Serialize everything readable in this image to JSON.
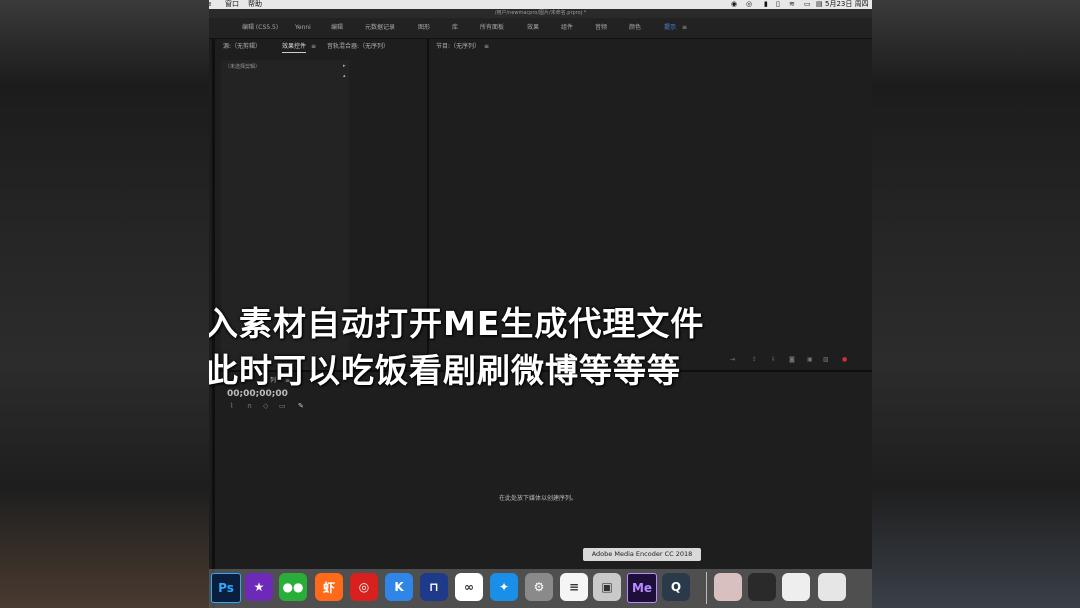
{
  "menubar": {
    "left_items": [
      "窗口",
      "帮助"
    ],
    "date": "5月23日 周四"
  },
  "window": {
    "title": "/用户/newmacpro/图片/未命名.prproj *"
  },
  "workspaces": [
    {
      "label": "编辑 (CS5.5)",
      "active": false
    },
    {
      "label": "Yenni",
      "active": false
    },
    {
      "label": "编辑",
      "active": false
    },
    {
      "label": "元数据记录",
      "active": false
    },
    {
      "label": "图形",
      "active": false
    },
    {
      "label": "库",
      "active": false
    },
    {
      "label": "所有面板",
      "active": false
    },
    {
      "label": "效果",
      "active": false
    },
    {
      "label": "组件",
      "active": false
    },
    {
      "label": "音频",
      "active": false
    },
    {
      "label": "颜色",
      "active": false
    },
    {
      "label": "提示",
      "active": true
    }
  ],
  "source_panel": {
    "tabs": [
      "源:（无剪辑）",
      "效果控件",
      "音轨混合器:（无序列）"
    ],
    "no_clip_label": "（未选择剪辑）"
  },
  "program_panel": {
    "tab": "节目:（无序列）"
  },
  "subtitles": {
    "line1": "入素材自动打开ME生成代理文件",
    "line2": "此时可以吃饭看剧刷微博等等等"
  },
  "timeline": {
    "tab_partial": "列",
    "timecode": "00;00;00;00",
    "empty_hint": "在此处放下媒体以创建序列。"
  },
  "dock": {
    "tooltip": "Adobe Media Encoder CC 2018",
    "apps": [
      {
        "icon": "photoshop-icon",
        "label": "Ps",
        "color": "#0a1f3d"
      },
      {
        "icon": "imovie-star-icon",
        "label": "★",
        "color": "#6d2ab8"
      },
      {
        "icon": "wechat-icon",
        "label": "●●",
        "color": "#2aae3a"
      },
      {
        "icon": "xiami-icon",
        "label": "虾",
        "color": "#ff6a1a"
      },
      {
        "icon": "netease-music-icon",
        "label": "◎",
        "color": "#d8201e"
      },
      {
        "icon": "kuwo-icon",
        "label": "K",
        "color": "#2f86e6"
      },
      {
        "icon": "keynote-icon",
        "label": "⊓",
        "color": "#1f3a8a"
      },
      {
        "icon": "baidu-netdisk-icon",
        "label": "∞",
        "color": "#ffffff"
      },
      {
        "icon": "safari-icon",
        "label": "✦",
        "color": "#1a8fe8"
      },
      {
        "icon": "system-preferences-icon",
        "label": "⚙",
        "color": "#8a8a8a"
      },
      {
        "icon": "notes-icon",
        "label": "≡",
        "color": "#f5f5f5"
      },
      {
        "icon": "preview-icon",
        "label": "▣",
        "color": "#c9c9c9"
      },
      {
        "icon": "media-encoder-icon",
        "label": "Me",
        "color": "#1d0f3a"
      },
      {
        "icon": "quicktime-icon",
        "label": "Q",
        "color": "#2a3a4a"
      },
      {
        "icon": "photo-thumbnail-icon",
        "label": "",
        "color": "#d8c0c0"
      },
      {
        "icon": "screenshot-thumbnail-icon",
        "label": "",
        "color": "#2a2a2a"
      },
      {
        "icon": "document-thumbnail-icon",
        "label": "",
        "color": "#eeeeee"
      },
      {
        "icon": "trash-icon",
        "label": "",
        "color": "#e6e6e6"
      }
    ]
  }
}
